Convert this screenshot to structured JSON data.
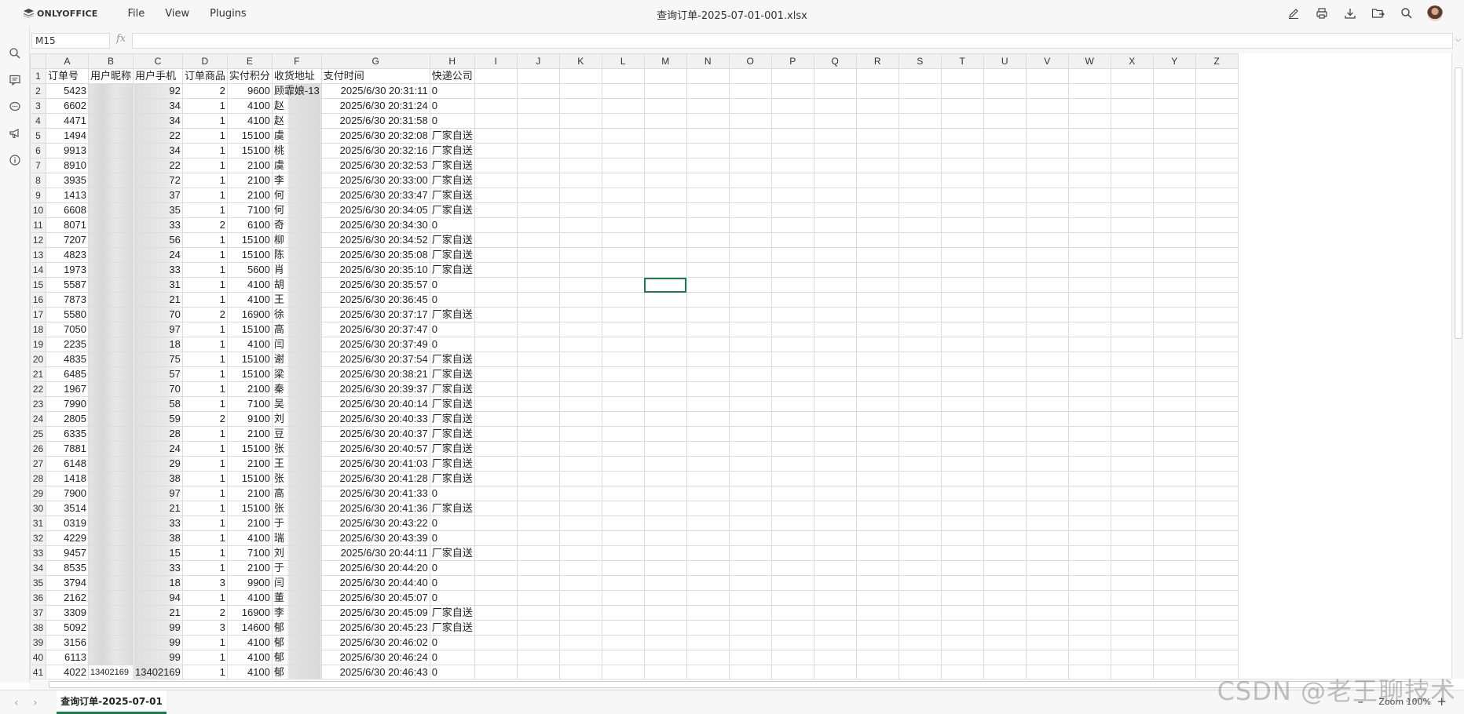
{
  "app": {
    "logo_text": "ONLYOFFICE",
    "menu": [
      "File",
      "View",
      "Plugins"
    ],
    "doc_title": "查询订单-2025-07-01-001.xlsx"
  },
  "formula_bar": {
    "name_box": "M15",
    "fx": "fx",
    "formula": ""
  },
  "columns": [
    "A",
    "B",
    "C",
    "D",
    "E",
    "F",
    "G",
    "H",
    "I",
    "J",
    "K",
    "L",
    "M",
    "N",
    "O",
    "P",
    "Q",
    "R",
    "S",
    "T",
    "U",
    "V",
    "W",
    "X",
    "Y",
    "Z"
  ],
  "selected_column": "M",
  "selected_row": 15,
  "header_row": [
    "订单号",
    "用户昵称",
    "用户手机",
    "订单商品",
    "实付积分",
    "收货地址",
    "支付时间",
    "快递公司"
  ],
  "rows": [
    {
      "a": "5423",
      "c": "92",
      "d": "2",
      "e": "9600",
      "f": "顾霏娘-13",
      "g": "2025/6/30 20:31:11",
      "h": "0"
    },
    {
      "a": "6602",
      "c": "34",
      "d": "1",
      "e": "4100",
      "f": "赵",
      "g": "2025/6/30 20:31:24",
      "h": "0"
    },
    {
      "a": "4471",
      "c": "34",
      "d": "1",
      "e": "4100",
      "f": "赵",
      "g": "2025/6/30 20:31:58",
      "h": "0"
    },
    {
      "a": "1494",
      "c": "22",
      "d": "1",
      "e": "15100",
      "f": "虞",
      "g": "2025/6/30 20:32:08",
      "h": "厂家自送"
    },
    {
      "a": "9913",
      "c": "34",
      "d": "1",
      "e": "15100",
      "f": "桃",
      "g": "2025/6/30 20:32:16",
      "h": "厂家自送"
    },
    {
      "a": "8910",
      "c": "22",
      "d": "1",
      "e": "2100",
      "f": "虞",
      "g": "2025/6/30 20:32:53",
      "h": "厂家自送"
    },
    {
      "a": "3935",
      "c": "72",
      "d": "1",
      "e": "2100",
      "f": "李",
      "g": "2025/6/30 20:33:00",
      "h": "厂家自送"
    },
    {
      "a": "1413",
      "c": "37",
      "d": "1",
      "e": "2100",
      "f": "何",
      "g": "2025/6/30 20:33:47",
      "h": "厂家自送"
    },
    {
      "a": "6608",
      "c": "35",
      "d": "1",
      "e": "7100",
      "f": "何",
      "g": "2025/6/30 20:34:05",
      "h": "厂家自送"
    },
    {
      "a": "8071",
      "c": "33",
      "d": "2",
      "e": "6100",
      "f": "奇",
      "g": "2025/6/30 20:34:30",
      "h": "0"
    },
    {
      "a": "7207",
      "c": "56",
      "d": "1",
      "e": "15100",
      "f": "柳",
      "g": "2025/6/30 20:34:52",
      "h": "厂家自送"
    },
    {
      "a": "4823",
      "c": "24",
      "d": "1",
      "e": "15100",
      "f": "陈",
      "g": "2025/6/30 20:35:08",
      "h": "厂家自送"
    },
    {
      "a": "1973",
      "c": "33",
      "d": "1",
      "e": "5600",
      "f": "肖",
      "g": "2025/6/30 20:35:10",
      "h": "厂家自送"
    },
    {
      "a": "5587",
      "c": "31",
      "d": "1",
      "e": "4100",
      "f": "胡",
      "g": "2025/6/30 20:35:57",
      "h": "0"
    },
    {
      "a": "7873",
      "c": "21",
      "d": "1",
      "e": "4100",
      "f": "王",
      "g": "2025/6/30 20:36:45",
      "h": "0"
    },
    {
      "a": "5580",
      "c": "70",
      "d": "2",
      "e": "16900",
      "f": "徐",
      "g": "2025/6/30 20:37:17",
      "h": "厂家自送"
    },
    {
      "a": "7050",
      "c": "97",
      "d": "1",
      "e": "15100",
      "f": "高",
      "g": "2025/6/30 20:37:47",
      "h": "0"
    },
    {
      "a": "2235",
      "c": "18",
      "d": "1",
      "e": "4100",
      "f": "闫",
      "g": "2025/6/30 20:37:49",
      "h": "0"
    },
    {
      "a": "4835",
      "c": "75",
      "d": "1",
      "e": "15100",
      "f": "谢",
      "g": "2025/6/30 20:37:54",
      "h": "厂家自送"
    },
    {
      "a": "6485",
      "c": "57",
      "d": "1",
      "e": "15100",
      "f": "梁",
      "g": "2025/6/30 20:38:21",
      "h": "厂家自送"
    },
    {
      "a": "1967",
      "c": "70",
      "d": "1",
      "e": "2100",
      "f": "秦",
      "g": "2025/6/30 20:39:37",
      "h": "厂家自送"
    },
    {
      "a": "7990",
      "c": "58",
      "d": "1",
      "e": "7100",
      "f": "吴",
      "g": "2025/6/30 20:40:14",
      "h": "厂家自送"
    },
    {
      "a": "2805",
      "c": "59",
      "d": "2",
      "e": "9100",
      "f": "刘",
      "g": "2025/6/30 20:40:33",
      "h": "厂家自送"
    },
    {
      "a": "6335",
      "c": "28",
      "d": "1",
      "e": "2100",
      "f": "豆",
      "g": "2025/6/30 20:40:37",
      "h": "厂家自送"
    },
    {
      "a": "7881",
      "c": "24",
      "d": "1",
      "e": "15100",
      "f": "张",
      "g": "2025/6/30 20:40:57",
      "h": "厂家自送"
    },
    {
      "a": "6148",
      "c": "29",
      "d": "1",
      "e": "2100",
      "f": "王",
      "g": "2025/6/30 20:41:03",
      "h": "厂家自送"
    },
    {
      "a": "1418",
      "c": "38",
      "d": "1",
      "e": "15100",
      "f": "张",
      "g": "2025/6/30 20:41:28",
      "h": "厂家自送"
    },
    {
      "a": "7900",
      "c": "97",
      "d": "1",
      "e": "2100",
      "f": "高",
      "g": "2025/6/30 20:41:33",
      "h": "0"
    },
    {
      "a": "3514",
      "c": "21",
      "d": "1",
      "e": "15100",
      "f": "张",
      "g": "2025/6/30 20:41:36",
      "h": "厂家自送"
    },
    {
      "a": "0319",
      "c": "33",
      "d": "1",
      "e": "2100",
      "f": "于",
      "g": "2025/6/30 20:43:22",
      "h": "0"
    },
    {
      "a": "4229",
      "c": "38",
      "d": "1",
      "e": "4100",
      "f": "瑞",
      "g": "2025/6/30 20:43:39",
      "h": "0"
    },
    {
      "a": "9457",
      "c": "15",
      "d": "1",
      "e": "7100",
      "f": "刘",
      "g": "2025/6/30 20:44:11",
      "h": "厂家自送"
    },
    {
      "a": "8535",
      "c": "33",
      "d": "1",
      "e": "2100",
      "f": "于",
      "g": "2025/6/30 20:44:20",
      "h": "0"
    },
    {
      "a": "3794",
      "c": "18",
      "d": "3",
      "e": "9900",
      "f": "闫",
      "g": "2025/6/30 20:44:40",
      "h": "0"
    },
    {
      "a": "2162",
      "c": "94",
      "d": "1",
      "e": "4100",
      "f": "董",
      "g": "2025/6/30 20:45:07",
      "h": "0"
    },
    {
      "a": "3309",
      "c": "21",
      "d": "2",
      "e": "16900",
      "f": "李",
      "g": "2025/6/30 20:45:09",
      "h": "厂家自送"
    },
    {
      "a": "5092",
      "c": "99",
      "d": "3",
      "e": "14600",
      "f": "郁",
      "g": "2025/6/30 20:45:23",
      "h": "厂家自送"
    },
    {
      "a": "3156",
      "c": "99",
      "d": "1",
      "e": "4100",
      "f": "郁",
      "g": "2025/6/30 20:46:02",
      "h": "0"
    },
    {
      "a": "6113",
      "c": "99",
      "d": "1",
      "e": "4100",
      "f": "郁",
      "g": "2025/6/30 20:46:24",
      "h": "0"
    },
    {
      "a": "4022",
      "c": "13402169",
      "d": "1",
      "e": "4100",
      "f": "郁",
      "g": "2025/6/30 20:46:43",
      "h": "0",
      "b": "13402169"
    }
  ],
  "sheet_tab": "查询订单-2025-07-01",
  "zoom_label": "Zoom 100%",
  "watermark": "CSDN @老王聊技术",
  "colors": {
    "accent": "#1f7a4d",
    "header_bg": "#f1f1f1",
    "chrome_bg": "#f7f7f7"
  }
}
